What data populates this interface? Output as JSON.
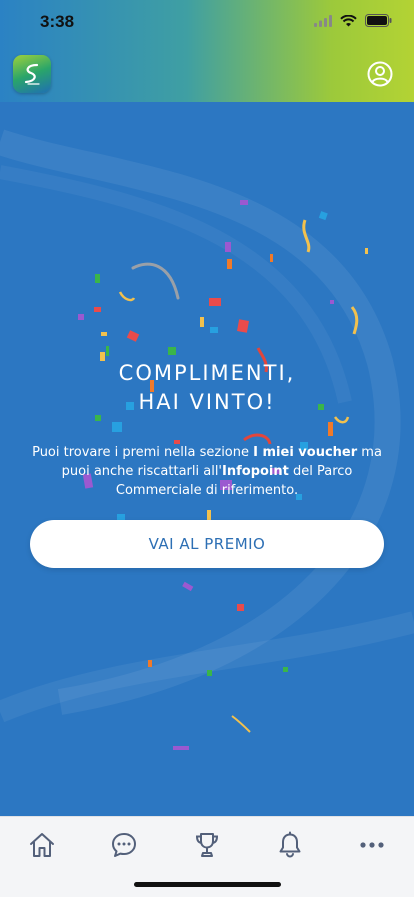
{
  "status_bar": {
    "time": "3:38"
  },
  "header": {
    "logo_icon": "app-logo-icon",
    "profile_icon": "user-circle-icon"
  },
  "congrats": {
    "title_line1": "COMPLIMENTI,",
    "title_line2": "HAI VINTO!",
    "message_part1": "Puoi trovare i premi nella sezione ",
    "message_bold1": "I miei voucher",
    "message_part2": " ma puoi anche riscattarli all'",
    "message_bold2": "Infopoint",
    "message_part3": " del Parco Commerciale di riferimento.",
    "cta_label": "VAI AL PREMIO"
  },
  "tab_bar": {
    "tabs": [
      {
        "icon": "home-icon"
      },
      {
        "icon": "chat-icon"
      },
      {
        "icon": "trophy-icon"
      },
      {
        "icon": "bell-icon"
      },
      {
        "icon": "more-icon"
      }
    ]
  },
  "colors": {
    "main_background": "#2c77c2",
    "cta_text": "#2d6fb4",
    "header_gradient_start": "#2b82c4",
    "header_gradient_end": "#b3d334"
  }
}
